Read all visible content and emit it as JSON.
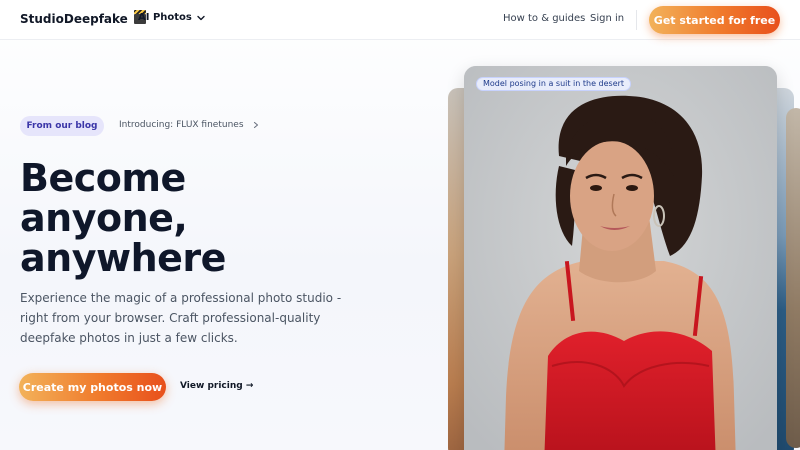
{
  "header": {
    "brand": "StudioDeepfake",
    "brand_icon": "clapperboard-icon",
    "ai_menu_label": "AI Photos",
    "nav": [
      {
        "label": "How to & guides"
      },
      {
        "label": "Sign in"
      }
    ],
    "cta_label": "Get started for free"
  },
  "hero": {
    "blog_badge": "From our blog",
    "blog_link": "Introducing: FLUX finetunes",
    "title_lines": [
      "Become",
      "anyone,",
      "anywhere"
    ],
    "subtitle_lines": [
      "Experience the magic of a professional photo studio -",
      "right from your browser. Craft professional-quality",
      "deepfake photos in just a few clicks."
    ],
    "primary_cta": "Create my photos now",
    "secondary_cta": "View pricing →"
  },
  "showcase": {
    "caption": "Model posing in a suit in the desert"
  },
  "colors": {
    "accent_start": "#f2b25a",
    "accent_end": "#e8501c",
    "badge_bg": "#e6e5fb",
    "badge_text": "#3b36a8",
    "title_text": "#0f172a"
  }
}
